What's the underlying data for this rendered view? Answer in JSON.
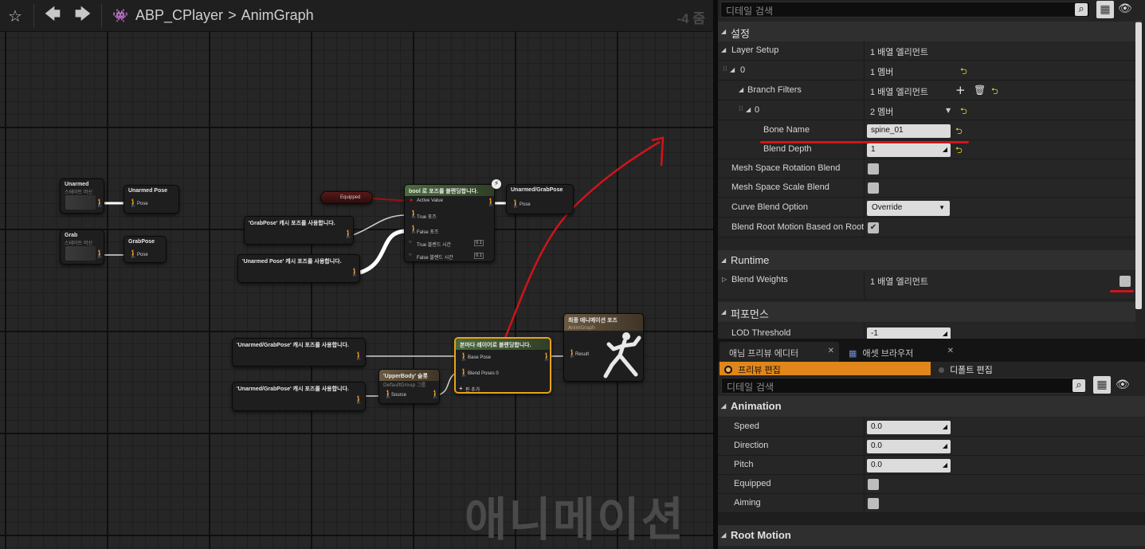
{
  "graph": {
    "toolbar": {
      "star_icon": "star-outline",
      "back_icon": "arrow-left",
      "forward_icon": "arrow-right",
      "asset_icon": "anim-blueprint",
      "breadcrumb": [
        "ABP_CPlayer",
        "AnimGraph"
      ],
      "crumb_separator": ">",
      "zoom": "-4 줌"
    },
    "watermark": "애니메이션",
    "nodes": {
      "unarmed_sm": {
        "title": "Unarmed",
        "subtitle": "스테이트 머신"
      },
      "unarmed_pose": {
        "title": "Unarmed Pose",
        "pin": "Pose"
      },
      "grab_sm": {
        "title": "Grab",
        "subtitle": "스테이트 머신"
      },
      "grab_pose": {
        "title": "GrabPose",
        "pin": "Pose"
      },
      "equipped": {
        "title": "Equipped"
      },
      "blend_bool": {
        "title": "bool 로 포즈를 블렌딩합니다.",
        "pins": [
          "Active Value",
          "True 포즈",
          "False 포즈",
          "True 블렌드 시간",
          "False 블렌드 시간"
        ],
        "true_time": "0.1",
        "false_time": "0.1"
      },
      "cache_grab": {
        "title": "'GrabPose' 캐시 포즈를 사용합니다."
      },
      "cache_unarmed": {
        "title": "'Unarmed Pose' 캐시 포즈를 사용합니다."
      },
      "unarmed_grab_pose": {
        "title": "Unarmed/GrabPose",
        "pin": "Pose"
      },
      "cache_ug_1": {
        "title": "'Unarmed/GrabPose' 캐시 포즈를 사용합니다."
      },
      "cache_ug_2": {
        "title": "'Unarmed/GrabPose' 캐시 포즈를 사용합니다."
      },
      "upperbody_slot": {
        "title": "'UpperBody' 슬롯",
        "subtitle": "DefaultGroup 그룹",
        "pin": "Source"
      },
      "layered_blend": {
        "title": "본마다 레이어로 블렌딩합니다.",
        "pins": [
          "Base Pose",
          "Blend Poses 0",
          "핀 추가"
        ]
      },
      "output_pose": {
        "title": "최종 애니메이션 포즈",
        "subtitle": "AnimGraph",
        "pin": "Result"
      }
    }
  },
  "details": {
    "search": {
      "placeholder": "디테일 검색"
    },
    "section_settings": "설정",
    "layer_setup": {
      "label": "Layer Setup",
      "value": "1 배열 엘리먼트"
    },
    "index0": {
      "label": "0",
      "value": "1 멤버"
    },
    "branch_filters": {
      "label": "Branch Filters",
      "value": "1 배열 엘리먼트"
    },
    "bf_index0": {
      "label": "0",
      "value": "2 멤버"
    },
    "bone_name": {
      "label": "Bone Name",
      "value": "spine_01"
    },
    "blend_depth": {
      "label": "Blend Depth",
      "value": "1"
    },
    "mesh_rot_blend": {
      "label": "Mesh Space Rotation Blend",
      "checked": false
    },
    "mesh_scale_blend": {
      "label": "Mesh Space Scale Blend",
      "checked": false
    },
    "curve_blend": {
      "label": "Curve Blend Option",
      "value": "Override"
    },
    "blend_root_motion": {
      "label": "Blend Root Motion Based on Root Bone",
      "checked": true
    },
    "section_runtime": "Runtime",
    "blend_weights": {
      "label": "Blend Weights",
      "value": "1 배열 엘리먼트"
    },
    "section_performance": "퍼포먼스",
    "lod_threshold": {
      "label": "LOD Threshold",
      "value": "-1"
    }
  },
  "preview": {
    "tabs": [
      {
        "label": "애님 프리뷰 에디터"
      },
      {
        "label": "애셋 브라우저"
      }
    ],
    "mode_preview": "프리뷰 편집",
    "mode_default": "디폴트 편집",
    "search": {
      "placeholder": "디테일 검색"
    },
    "section_animation": "Animation",
    "speed": {
      "label": "Speed",
      "value": "0.0"
    },
    "direction": {
      "label": "Direction",
      "value": "0.0"
    },
    "pitch": {
      "label": "Pitch",
      "value": "0.0"
    },
    "equipped": {
      "label": "Equipped",
      "checked": false
    },
    "aiming": {
      "label": "Aiming",
      "checked": false
    },
    "section_root_motion": "Root Motion"
  },
  "colors": {
    "accent_orange": "#e0861a",
    "annotation_red": "#d0141a",
    "reset_yellow": "#e6d23a"
  }
}
